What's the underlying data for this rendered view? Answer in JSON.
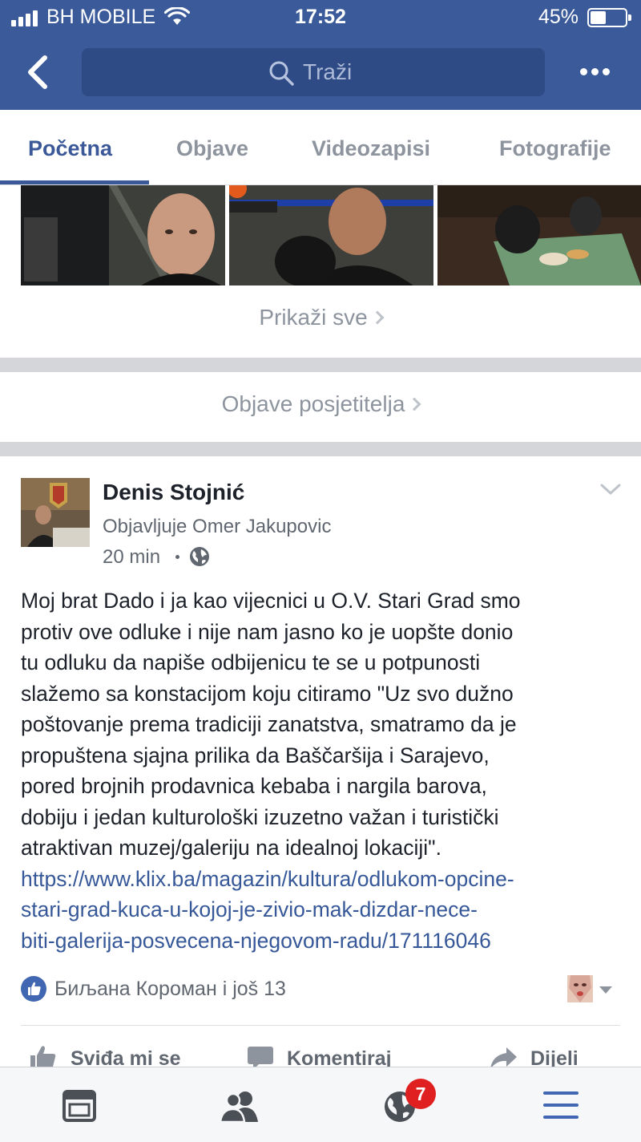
{
  "status_bar": {
    "carrier": "BH MOBILE",
    "time": "17:52",
    "battery_pct": "45%",
    "battery_level": 0.45
  },
  "header": {
    "search_placeholder": "Traži",
    "back_icon": "chevron-left-icon",
    "more_icon": "more-dots-icon"
  },
  "tabs": [
    {
      "label": "Početna",
      "active": true
    },
    {
      "label": "Objave",
      "active": false
    },
    {
      "label": "Videozapisi",
      "active": false
    },
    {
      "label": "Fotografije",
      "active": false
    }
  ],
  "photos": {
    "show_all": "Prikaži sve"
  },
  "visitor_posts": {
    "label": "Objave posjetitelja"
  },
  "post": {
    "author": "Denis Stojnić",
    "posted_by": "Objavljuje Omer Jakupovic",
    "time": "20 min",
    "audience_icon": "globe-icon",
    "body_lines": [
      "Moj brat Dado i ja kao vijecnici u O.V. Stari Grad smo",
      "protiv ove odluke i nije nam jasno ko je uopšte donio",
      "tu odluku da napiše odbijenicu te se u potpunosti",
      "slažemo sa konstacijom koju  citiramo \"Uz svo dužno",
      "poštovanje prema tradiciji zanatstva, smatramo da je",
      "propuštena sjajna prilika da Baščaršija i Sarajevo,",
      "pored brojnih prodavnica kebaba i nargila barova,",
      "dobiju i jedan kulturološki izuzetno važan i turistički",
      "atraktivan muzej/galeriju na idealnoj lokaciji\"."
    ],
    "link_lines": [
      "https://www.klix.ba/magazin/kultura/odlukom-opcine-",
      "stari-grad-kuca-u-kojoj-je-zivio-mak-dizdar-nece-",
      "biti-galerija-posvecena-njegovom-radu/171116046"
    ],
    "reactions_text": "Биљана Короман i još 13",
    "actions": {
      "like": "Sviđa mi se",
      "comment": "Komentiraj",
      "share": "Dijeli"
    }
  },
  "bottom_nav": {
    "notifications_badge": "7",
    "colors": {
      "active": "#4267b2",
      "inactive": "#4b4f56",
      "badge": "#e02020"
    }
  },
  "colors": {
    "brand": "#3b5a9a",
    "link": "#365899",
    "muted": "#8d949e"
  }
}
